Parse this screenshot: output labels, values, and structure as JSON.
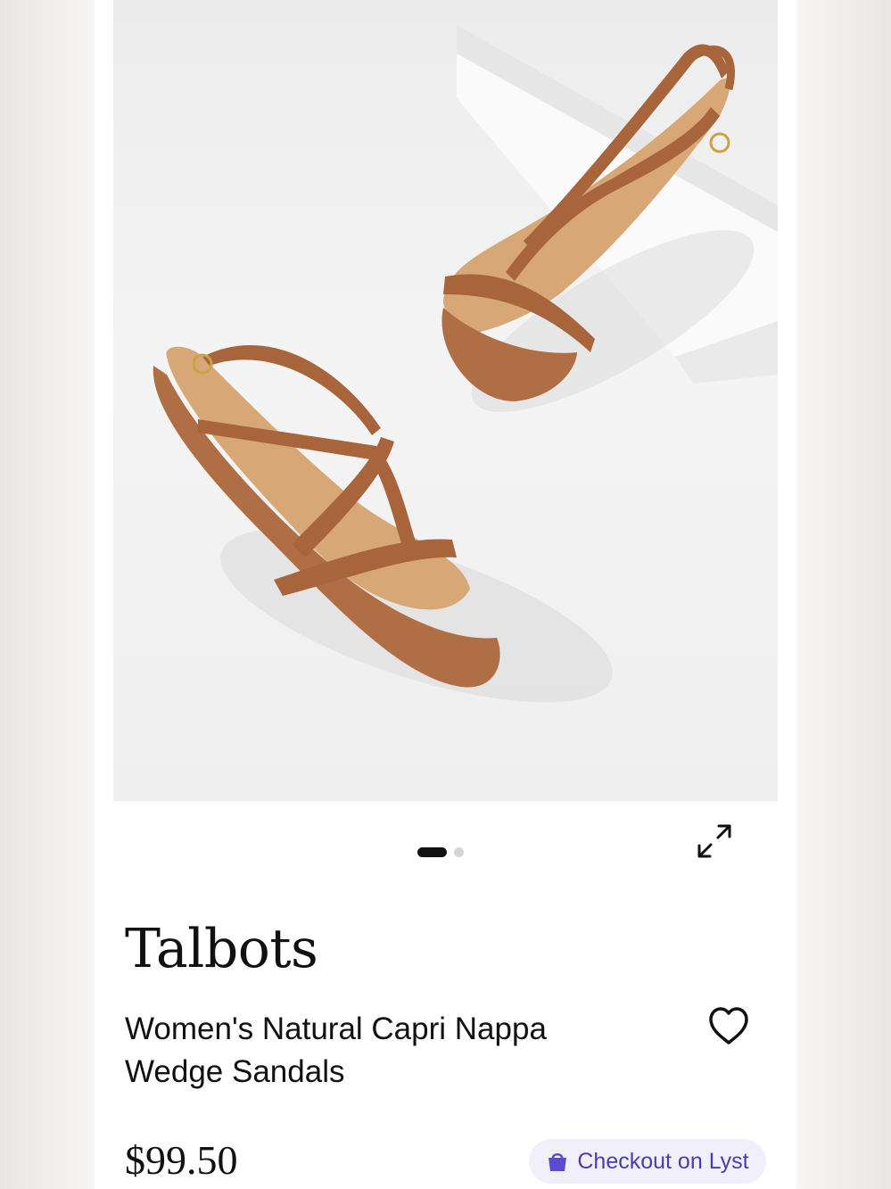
{
  "product": {
    "brand": "Talbots",
    "name": "Women's Natural Capri Nappa Wedge Sandals",
    "price": "$99.50",
    "image_alt": "Women's Natural Capri Nappa Wedge Sandals"
  },
  "gallery": {
    "image_count": 2,
    "active_index": 0
  },
  "actions": {
    "expand_icon": "expand-icon",
    "wishlist_icon": "heart-icon",
    "checkout_label": "Checkout on Lyst",
    "checkout_icon": "shopping-bag-icon"
  },
  "colors": {
    "checkout_background": "#f1effa",
    "checkout_text": "#4a3fa8",
    "sandal_leather": "#a8643a",
    "sandal_footbed": "#d7a876"
  }
}
